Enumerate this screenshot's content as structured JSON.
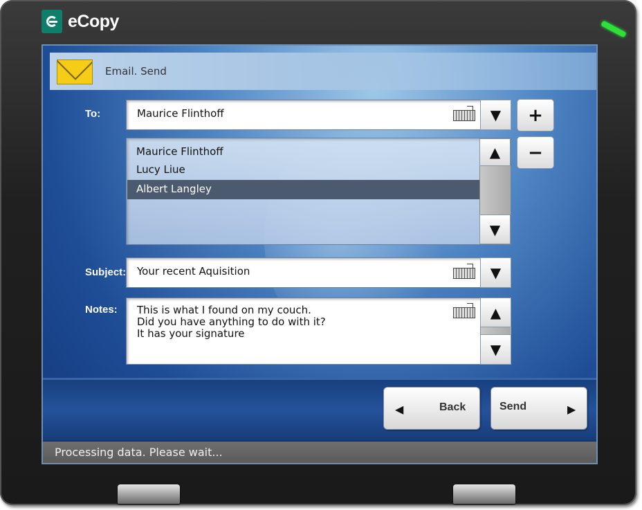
{
  "app": {
    "brand": "eCopy"
  },
  "header": {
    "title": "Email. Send",
    "icon": "envelope-icon"
  },
  "to": {
    "label": "To:",
    "value": "Maurice Flinthoff",
    "recipients": [
      "Maurice Flinthoff",
      "Lucy Liue",
      "Albert Langley"
    ],
    "selected": "Albert Langley",
    "add_label": "+",
    "remove_label": "−"
  },
  "subject": {
    "label": "Subject:",
    "value": "Your recent Aquisition"
  },
  "notes": {
    "label": "Notes:",
    "value": "This is what I found on my couch.\nDid you have anything to do with it?\nIt has your signature"
  },
  "actions": {
    "back_label": "Back",
    "send_label": "Send"
  },
  "status": {
    "message": "Processing data. Please wait..."
  },
  "colors": {
    "led": "#2fe03a",
    "screen_blue": "#1e4d96",
    "selection": "#4b5a6e",
    "envelope": "#f5cc16"
  }
}
